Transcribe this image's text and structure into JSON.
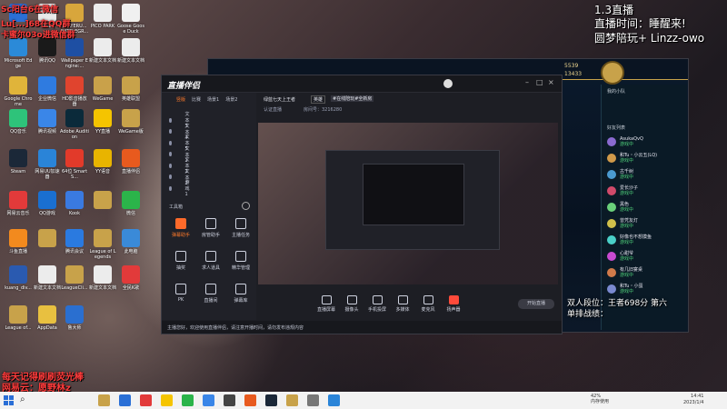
{
  "overlay": {
    "top_left_1": "Sc阳台6在微信",
    "top_left_2": "Lu[...]68在QQ群",
    "top_left_3": "卡蜜尔03o进微信群",
    "top_right_line1": "1.3直播",
    "top_right_line2": "直播时间：睡醒来!",
    "top_right_line3": "圆梦陪玩+ Linzz-owo",
    "bottom_left_1": "每天记得刷刷荧光棒",
    "bottom_left_2": "网易云：愿野林z",
    "rank_line1": "双人段位：王者698分 第六",
    "rank_line2": "单排战绩："
  },
  "desktop_icons": [
    {
      "label": "",
      "color": "#2a6fd6"
    },
    {
      "label": "ELL",
      "color": "#e9e9e9"
    },
    {
      "label": "PLAYERU... BATTLEGR...",
      "color": "#d8a63c"
    },
    {
      "label": "PICO PARK",
      "color": "#ececec"
    },
    {
      "label": "Goose Goose Duck",
      "color": "#f0f0f0"
    },
    {
      "label": "Microsoft Edge",
      "color": "#2b8ad8"
    },
    {
      "label": "腾讯QQ",
      "color": "#1a1a1a"
    },
    {
      "label": "Wallpaper Engine:...",
      "color": "#1e4fa3"
    },
    {
      "label": "新建文本文档",
      "color": "#ececec"
    },
    {
      "label": "新建文本文档",
      "color": "#ececec"
    },
    {
      "label": "Google Chrome",
      "color": "#e0b43a"
    },
    {
      "label": "企业微信",
      "color": "#2f7be0"
    },
    {
      "label": "HD影音播放器",
      "color": "#e0442e"
    },
    {
      "label": "WeGame",
      "color": "#c9a14a"
    },
    {
      "label": "英雄联盟",
      "color": "#c8a24a"
    },
    {
      "label": "QQ音乐",
      "color": "#2ec37a"
    },
    {
      "label": "腾讯视频",
      "color": "#3a86e8"
    },
    {
      "label": "Adobe Audition",
      "color": "#0b2a3a"
    },
    {
      "label": "YY直播",
      "color": "#f5c400"
    },
    {
      "label": "WeGame版",
      "color": "#c8a24a"
    },
    {
      "label": "Steam",
      "color": "#1b2838"
    },
    {
      "label": "网易UU加速器",
      "color": "#2a84d8"
    },
    {
      "label": "64位 SmartS...",
      "color": "#e23a2a"
    },
    {
      "label": "YY语音",
      "color": "#e8b400"
    },
    {
      "label": "直播伴侣",
      "color": "#e85a1e"
    },
    {
      "label": "网易云音乐",
      "color": "#e23a3a"
    },
    {
      "label": "QQ游戏",
      "color": "#1a6fd0"
    },
    {
      "label": "Kook",
      "color": "#3a7ae0"
    },
    {
      "label": "",
      "color": "#c8a24a"
    },
    {
      "label": "微信",
      "color": "#2bb44a"
    },
    {
      "label": "斗鱼直播",
      "color": "#f28a1e"
    },
    {
      "label": "",
      "color": "#c8a24a"
    },
    {
      "label": "腾讯会议",
      "color": "#2a7ae0"
    },
    {
      "label": "League of Legends",
      "color": "#c8a24a"
    },
    {
      "label": "此电脑",
      "color": "#3a8ad8"
    },
    {
      "label": "kuang_div...",
      "color": "#2a5ab0"
    },
    {
      "label": "新建文本文档",
      "color": "#ececec"
    },
    {
      "label": "LeagueCli...",
      "color": "#c8a24a"
    },
    {
      "label": "新建文本文档",
      "color": "#ececec"
    },
    {
      "label": "全民K歌",
      "color": "#e23a3a"
    },
    {
      "label": "League of...",
      "color": "#c8a24a"
    },
    {
      "label": "AppData",
      "color": "#e8c040"
    },
    {
      "label": "鲁大师",
      "color": "#2a6fd0"
    }
  ],
  "streamer_app": {
    "logo": "直播伴侣",
    "scene_tabs": [
      "竖版",
      "比赛",
      "场景1",
      "场景2"
    ],
    "sources": [
      "文本 3",
      "文本 4",
      "文本 5",
      "文本 1",
      "文本 2",
      "文本 3",
      "游戏 1"
    ],
    "toolbox_label": "工具箱",
    "tools": [
      "弹幕助手",
      "房管助手",
      "主播任务",
      "抽奖",
      "求人道具",
      "精华管理",
      "PK",
      "直播间",
      "弹幕库"
    ],
    "room_title": "绿蓝七天上王者",
    "room_tag_1": "英雄",
    "room_tag_2": "#在线陪玩#全新房",
    "room_info_1": "认证直播",
    "room_info_2": "房间号：3216280",
    "bottom_buttons": [
      "直播屏幕",
      "摄像头",
      "手机投屏",
      "多媒体",
      "麦克风",
      "扬声器"
    ],
    "start_button": "开始直播",
    "notice": "主播您好，欢迎使用直播伴侣，请注意开播时间，请勿发布违规内容"
  },
  "lol_client": {
    "stat_1": "5539",
    "stat_2": "13433",
    "friends_header": "好友列表",
    "group_label": "我的小队",
    "friends": [
      {
        "name": "AsukaQvQ",
        "status": "游戏中",
        "color": "#8a6ad0"
      },
      {
        "name": "和Tu・小云五(LQ)",
        "status": "游戏中",
        "color": "#d09a4a"
      },
      {
        "name": "古千树",
        "status": "游戏中",
        "color": "#4a9ad0"
      },
      {
        "name": "爱长沙子",
        "status": "游戏中",
        "color": "#d04a6a"
      },
      {
        "name": "黑色",
        "status": "游戏中",
        "color": "#6ad07a"
      },
      {
        "name": "曾凭友灯",
        "status": "游戏中",
        "color": "#d0c04a"
      },
      {
        "name": "好像也不想摸鱼",
        "status": "游戏中",
        "color": "#4ad0c8"
      },
      {
        "name": "心甜爷",
        "status": "游戏中",
        "color": "#c84ad0"
      },
      {
        "name": "有几旧宴桌",
        "status": "游戏中",
        "color": "#d07a4a"
      },
      {
        "name": "和Tu・小蛋",
        "status": "游戏中",
        "color": "#7a8ad0"
      }
    ]
  },
  "taskbar": {
    "search_icon": "search-icon",
    "battery_percent": "42%",
    "battery_label": "内存使用",
    "time": "14:41",
    "date": "2023/1/4"
  }
}
